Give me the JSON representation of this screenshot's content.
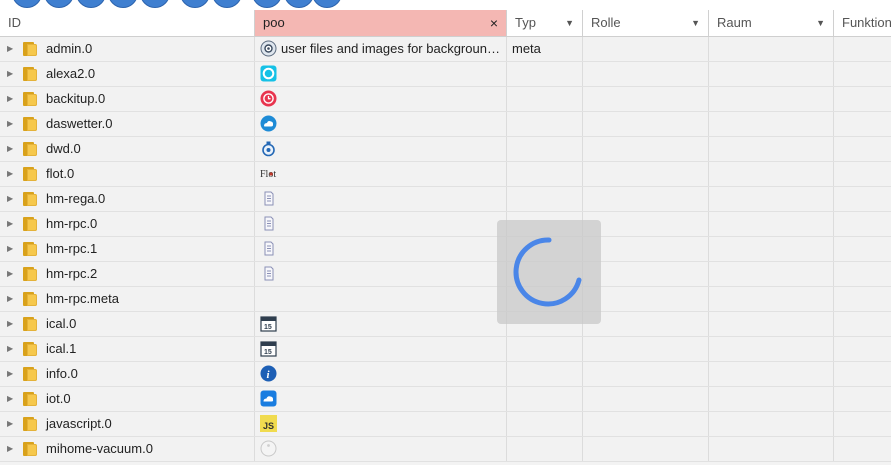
{
  "columns": {
    "id": "ID",
    "name": "poo",
    "typ": "Typ",
    "rolle": "Rolle",
    "raum": "Raum",
    "funktion": "Funktion"
  },
  "name_filter_clear": "×",
  "rows": [
    {
      "id": "admin.0",
      "icon": "admin-gear-icon",
      "name": "user files and images for backgroun…",
      "typ": "meta"
    },
    {
      "id": "alexa2.0",
      "icon": "alexa-icon",
      "name": "",
      "typ": ""
    },
    {
      "id": "backitup.0",
      "icon": "backitup-clock-icon",
      "name": "",
      "typ": ""
    },
    {
      "id": "daswetter.0",
      "icon": "weather-cloud-icon",
      "name": "",
      "typ": ""
    },
    {
      "id": "dwd.0",
      "icon": "dwd-icon",
      "name": "",
      "typ": ""
    },
    {
      "id": "flot.0",
      "icon": "flot-logo-icon",
      "name": "",
      "typ": ""
    },
    {
      "id": "hm-rega.0",
      "icon": "homematic-icon",
      "name": "",
      "typ": ""
    },
    {
      "id": "hm-rpc.0",
      "icon": "homematic-icon",
      "name": "",
      "typ": ""
    },
    {
      "id": "hm-rpc.1",
      "icon": "homematic-icon",
      "name": "",
      "typ": ""
    },
    {
      "id": "hm-rpc.2",
      "icon": "homematic-icon",
      "name": "",
      "typ": ""
    },
    {
      "id": "hm-rpc.meta",
      "icon": "",
      "name": "",
      "typ": ""
    },
    {
      "id": "ical.0",
      "icon": "calendar-icon",
      "name": "",
      "typ": ""
    },
    {
      "id": "ical.1",
      "icon": "calendar-icon",
      "name": "",
      "typ": ""
    },
    {
      "id": "info.0",
      "icon": "info-icon",
      "name": "",
      "typ": ""
    },
    {
      "id": "iot.0",
      "icon": "cloud-icon",
      "name": "",
      "typ": ""
    },
    {
      "id": "javascript.0",
      "icon": "javascript-icon",
      "name": "",
      "typ": ""
    },
    {
      "id": "mihome-vacuum.0",
      "icon": "vacuum-icon",
      "name": "",
      "typ": ""
    }
  ],
  "icon_text": {
    "flot": "Flot",
    "javascript": "JS",
    "info": "i",
    "calendar": "15"
  },
  "colors": {
    "filter_header": "#f4b7b3",
    "folder": "#f6c84c",
    "spinner": "#4a86e8"
  }
}
